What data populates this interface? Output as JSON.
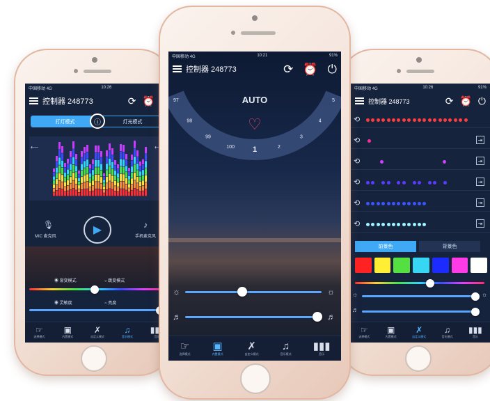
{
  "status": {
    "carrier": "中国移动",
    "network": "4G",
    "time_left": "10:26",
    "time_center": "10:21",
    "time_right": "10:26",
    "battery": "91%"
  },
  "app": {
    "title": "控制器 248773"
  },
  "tabs": [
    "选择模式",
    "内置模式",
    "自定义模式",
    "音乐模式",
    "音乐"
  ],
  "left": {
    "mode_tabs": [
      "打灯模式",
      "灯光模式"
    ],
    "mic_label": "MIC 麦克风",
    "phone_label": "手机麦克风",
    "options": [
      "渐变模式",
      "跳变模式",
      "灵敏度",
      "亮度"
    ],
    "colors": {
      "accent": "#3fa9f5"
    }
  },
  "center": {
    "mode": "AUTO",
    "dial_numbers": [
      "97",
      "98",
      "99",
      "100",
      "1",
      "2",
      "3",
      "4",
      "5"
    ],
    "brightness": 0.42,
    "speed": 0.97,
    "colors": {
      "dial": "#3a4f7c",
      "knob": "#ffffff",
      "track": "#5aa6ff"
    }
  },
  "right": {
    "rows": [
      {
        "type": "full",
        "color": "#ff3b3b"
      },
      {
        "type": "dot1",
        "color": "#ff2d9b"
      },
      {
        "type": "dot2",
        "color": "#d040ff"
      },
      {
        "type": "dash",
        "color": "#5a3cff"
      },
      {
        "type": "dots",
        "color": "#3b55ff"
      },
      {
        "type": "dots",
        "color": "#9ff3ff"
      }
    ],
    "tab_active": "前景色",
    "tab_inactive": "背景色",
    "swatches": [
      "#ff2222",
      "#ffee33",
      "#55e042",
      "#37d6f2",
      "#1c2bff",
      "#ff3be8",
      "#ffffff"
    ],
    "hue_value": 0.58,
    "slider1": 0.98,
    "slider2": 0.98
  }
}
